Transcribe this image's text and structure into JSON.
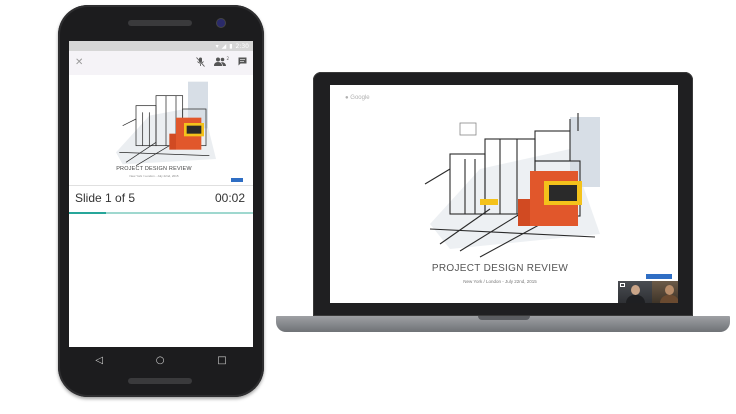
{
  "phone": {
    "status": {
      "wifi": "▾",
      "signal": "◢",
      "battery": "▮",
      "time": "2:30"
    },
    "app_bar": {
      "close_icon": "close-icon",
      "mic_icon": "mic-off-icon",
      "people_icon": "people-icon",
      "people_count": "2",
      "chat_icon": "chat-icon"
    },
    "slide": {
      "title": "PROJECT DESIGN REVIEW",
      "subtitle": "New York / London - July 22nd, 2015"
    },
    "slide_counter": "Slide 1 of 5",
    "timer": "00:02",
    "progress": 0.2,
    "nav": {
      "back": "◁",
      "home": "○",
      "recents": "□"
    }
  },
  "laptop": {
    "logo": "Google",
    "slide": {
      "title": "PROJECT DESIGN REVIEW",
      "subtitle": "New York / London - July 22nd, 2015"
    },
    "video_thumbnail": "video-call-thumbnail"
  },
  "colors": {
    "accent": "#26a69a",
    "progress_track": "#9fd8cf",
    "slide_tag": "#2f6ec4",
    "illustration_orange": "#e1572b",
    "illustration_yellow": "#f4c21b"
  }
}
